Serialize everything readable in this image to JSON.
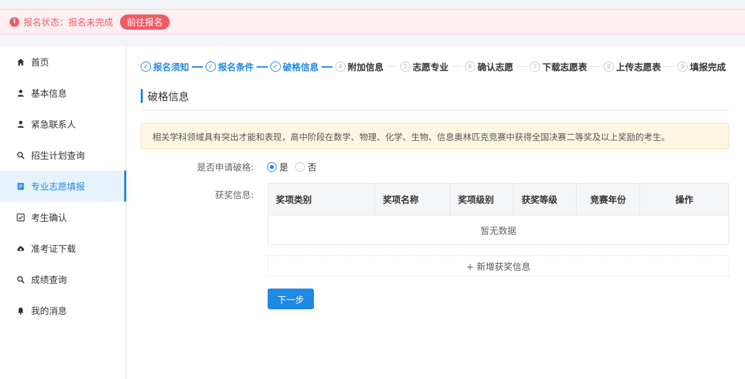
{
  "banner": {
    "status_text": "报名状态：报名未完成",
    "goto_button": "前往报名",
    "color": "#ee5b66"
  },
  "sidebar": {
    "items": [
      {
        "label": "首页",
        "icon": "home-icon",
        "active": false
      },
      {
        "label": "基本信息",
        "icon": "user-icon",
        "active": false
      },
      {
        "label": "紧急联系人",
        "icon": "user-icon",
        "active": false
      },
      {
        "label": "招生计划查询",
        "icon": "search-icon",
        "active": false
      },
      {
        "label": "专业志愿填报",
        "icon": "document-icon",
        "active": true
      },
      {
        "label": "考生确认",
        "icon": "checkbox-icon",
        "active": false
      },
      {
        "label": "准考证下载",
        "icon": "cloud-download-icon",
        "active": false
      },
      {
        "label": "成绩查询",
        "icon": "search-icon",
        "active": false
      },
      {
        "label": "我的消息",
        "icon": "bell-icon",
        "active": false
      }
    ]
  },
  "steps": [
    {
      "num": "✓",
      "label": "报名须知",
      "done": true
    },
    {
      "num": "✓",
      "label": "报名条件",
      "done": true
    },
    {
      "num": "✓",
      "label": "破格信息",
      "done": true
    },
    {
      "num": "4",
      "label": "附加信息",
      "done": false
    },
    {
      "num": "5",
      "label": "志愿专业",
      "done": false
    },
    {
      "num": "6",
      "label": "确认志愿",
      "done": false
    },
    {
      "num": "7",
      "label": "下载志愿表",
      "done": false
    },
    {
      "num": "8",
      "label": "上传志愿表",
      "done": false
    },
    {
      "num": "9",
      "label": "填报完成",
      "done": false
    }
  ],
  "section": {
    "title": "破格信息",
    "notice": "相关学科领域具有突出才能和表现，高中阶段在数学、物理、化学、生物、信息奥林匹克竞赛中获得全国决赛二等奖及以上奖励的考生。"
  },
  "form": {
    "apply_label": "是否申请破格:",
    "yes": "是",
    "no": "否",
    "selected": "是",
    "award_label": "获奖信息:"
  },
  "table": {
    "headers": [
      "奖项类别",
      "奖项名称",
      "奖项级别",
      "获奖等级",
      "竞赛年份",
      "操作"
    ],
    "empty_text": "暂无数据"
  },
  "add_award": "+ 新增获奖信息",
  "next_button": "下一步",
  "accent_color": "#1f88e5"
}
